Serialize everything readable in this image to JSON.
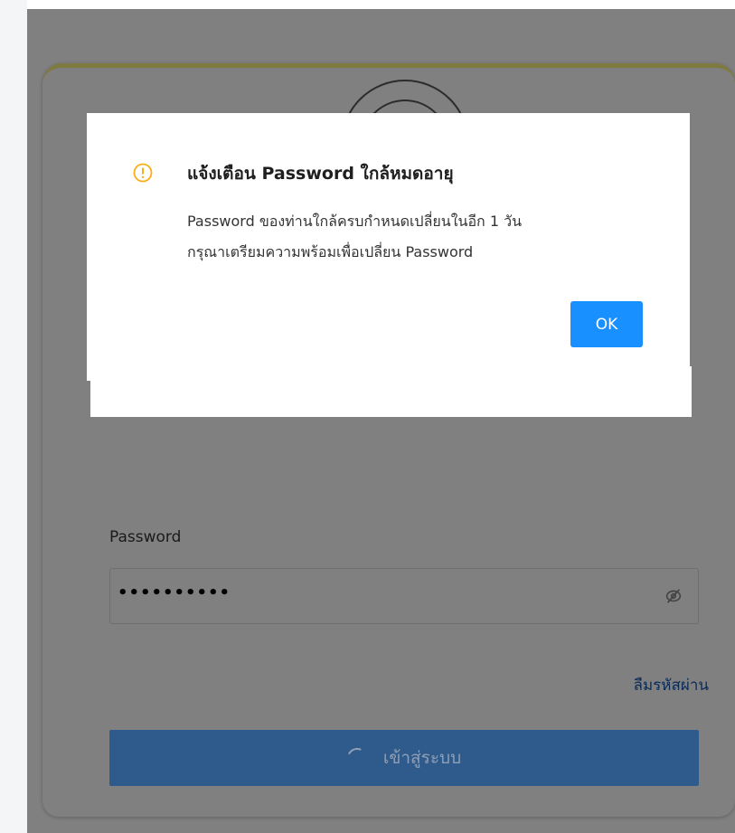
{
  "modal": {
    "title": "แจ้งเตือน Password ใกล้หมดอายุ",
    "message_line1": "Password ของท่านใกล้ครบกำหนดเปลี่ยนในอีก 1 วัน",
    "message_line2": "กรุณาเตรียมความพร้อมเพื่อเปลี่ยน Password",
    "ok_label": "OK",
    "icon": "warning-circle-icon",
    "icon_color": "#faad14",
    "ok_color": "#1890ff"
  },
  "login": {
    "password_label": "Password",
    "password_value": "••••••••••",
    "forgot_link": "ลืมรหัสผ่าน",
    "submit_label": "เข้าสู่ระบบ",
    "eye_icon": "eye-slash-icon",
    "spinner_icon": "loading-spinner-icon",
    "accent_color": "#d4c73a",
    "button_color": "#2f5b8c"
  }
}
